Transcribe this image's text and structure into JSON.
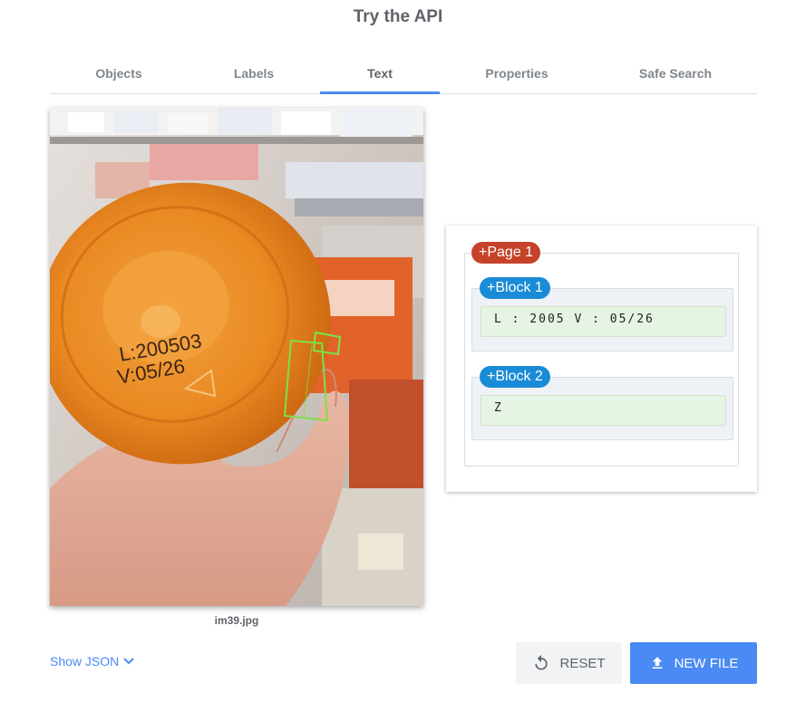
{
  "header": {
    "title": "Try the API"
  },
  "tabs": [
    {
      "label": "Objects"
    },
    {
      "label": "Labels"
    },
    {
      "label": "Text",
      "active": true
    },
    {
      "label": "Properties"
    },
    {
      "label": "Safe Search"
    }
  ],
  "image": {
    "filename": "im39.jpg",
    "bottle_text": [
      "L:200503",
      "V:05/26"
    ]
  },
  "results": {
    "page_label": "+Page 1",
    "blocks": [
      {
        "label": "+Block 1",
        "text": "L : 2005 V : 05/26"
      },
      {
        "label": "+Block 2",
        "text": "Z"
      }
    ]
  },
  "footer": {
    "show_json": "Show JSON",
    "reset_label": "RESET",
    "new_file_label": "NEW FILE"
  },
  "colors": {
    "accent": "#4a8af4",
    "page_pill": "#c5432a",
    "block_pill": "#1a8bd6",
    "bounding_box": "#7ee04a"
  },
  "icons": {
    "reset": "reset-icon",
    "upload": "upload-icon",
    "chevron": "chevron-down-icon"
  }
}
